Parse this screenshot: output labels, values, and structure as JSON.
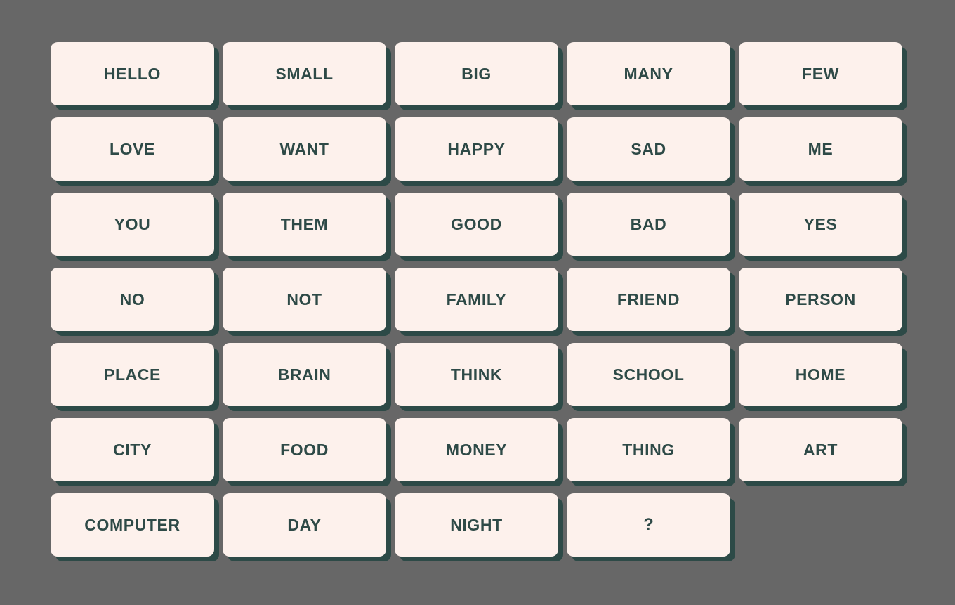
{
  "theme": {
    "background_color": "#676767",
    "button_fill_color": "#fdf1ec",
    "button_text_color": "#2e4a47",
    "button_shadow_color": "#2d4a47"
  },
  "grid": {
    "columns": 5,
    "rows": 7,
    "total_buttons": 34
  },
  "buttons": [
    {
      "label": "HELLO",
      "row": 1,
      "col": 1,
      "kind": "word"
    },
    {
      "label": "SMALL",
      "row": 1,
      "col": 2,
      "kind": "word"
    },
    {
      "label": "BIG",
      "row": 1,
      "col": 3,
      "kind": "word"
    },
    {
      "label": "MANY",
      "row": 1,
      "col": 4,
      "kind": "word"
    },
    {
      "label": "FEW",
      "row": 1,
      "col": 5,
      "kind": "word"
    },
    {
      "label": "LOVE",
      "row": 2,
      "col": 1,
      "kind": "word"
    },
    {
      "label": "WANT",
      "row": 2,
      "col": 2,
      "kind": "word"
    },
    {
      "label": "HAPPY",
      "row": 2,
      "col": 3,
      "kind": "word"
    },
    {
      "label": "SAD",
      "row": 2,
      "col": 4,
      "kind": "word"
    },
    {
      "label": "ME",
      "row": 2,
      "col": 5,
      "kind": "word"
    },
    {
      "label": "YOU",
      "row": 3,
      "col": 1,
      "kind": "word"
    },
    {
      "label": "THEM",
      "row": 3,
      "col": 2,
      "kind": "word"
    },
    {
      "label": "GOOD",
      "row": 3,
      "col": 3,
      "kind": "word"
    },
    {
      "label": "BAD",
      "row": 3,
      "col": 4,
      "kind": "word"
    },
    {
      "label": "YES",
      "row": 3,
      "col": 5,
      "kind": "word"
    },
    {
      "label": "NO",
      "row": 4,
      "col": 1,
      "kind": "word"
    },
    {
      "label": "NOT",
      "row": 4,
      "col": 2,
      "kind": "word"
    },
    {
      "label": "FAMILY",
      "row": 4,
      "col": 3,
      "kind": "word"
    },
    {
      "label": "FRIEND",
      "row": 4,
      "col": 4,
      "kind": "word"
    },
    {
      "label": "PERSON",
      "row": 4,
      "col": 5,
      "kind": "word"
    },
    {
      "label": "PLACE",
      "row": 5,
      "col": 1,
      "kind": "word"
    },
    {
      "label": "BRAIN",
      "row": 5,
      "col": 2,
      "kind": "word"
    },
    {
      "label": "THINK",
      "row": 5,
      "col": 3,
      "kind": "word"
    },
    {
      "label": "SCHOOL",
      "row": 5,
      "col": 4,
      "kind": "word"
    },
    {
      "label": "HOME",
      "row": 5,
      "col": 5,
      "kind": "word"
    },
    {
      "label": "CITY",
      "row": 6,
      "col": 1,
      "kind": "word"
    },
    {
      "label": "FOOD",
      "row": 6,
      "col": 2,
      "kind": "word"
    },
    {
      "label": "MONEY",
      "row": 6,
      "col": 3,
      "kind": "word"
    },
    {
      "label": "THING",
      "row": 6,
      "col": 4,
      "kind": "word"
    },
    {
      "label": "ART",
      "row": 6,
      "col": 5,
      "kind": "word"
    },
    {
      "label": "COMPUTER",
      "row": 7,
      "col": 1,
      "kind": "word"
    },
    {
      "label": "DAY",
      "row": 7,
      "col": 2,
      "kind": "word"
    },
    {
      "label": "NIGHT",
      "row": 7,
      "col": 3,
      "kind": "word"
    },
    {
      "label": "?",
      "row": 7,
      "col": 4,
      "kind": "unknown"
    }
  ]
}
